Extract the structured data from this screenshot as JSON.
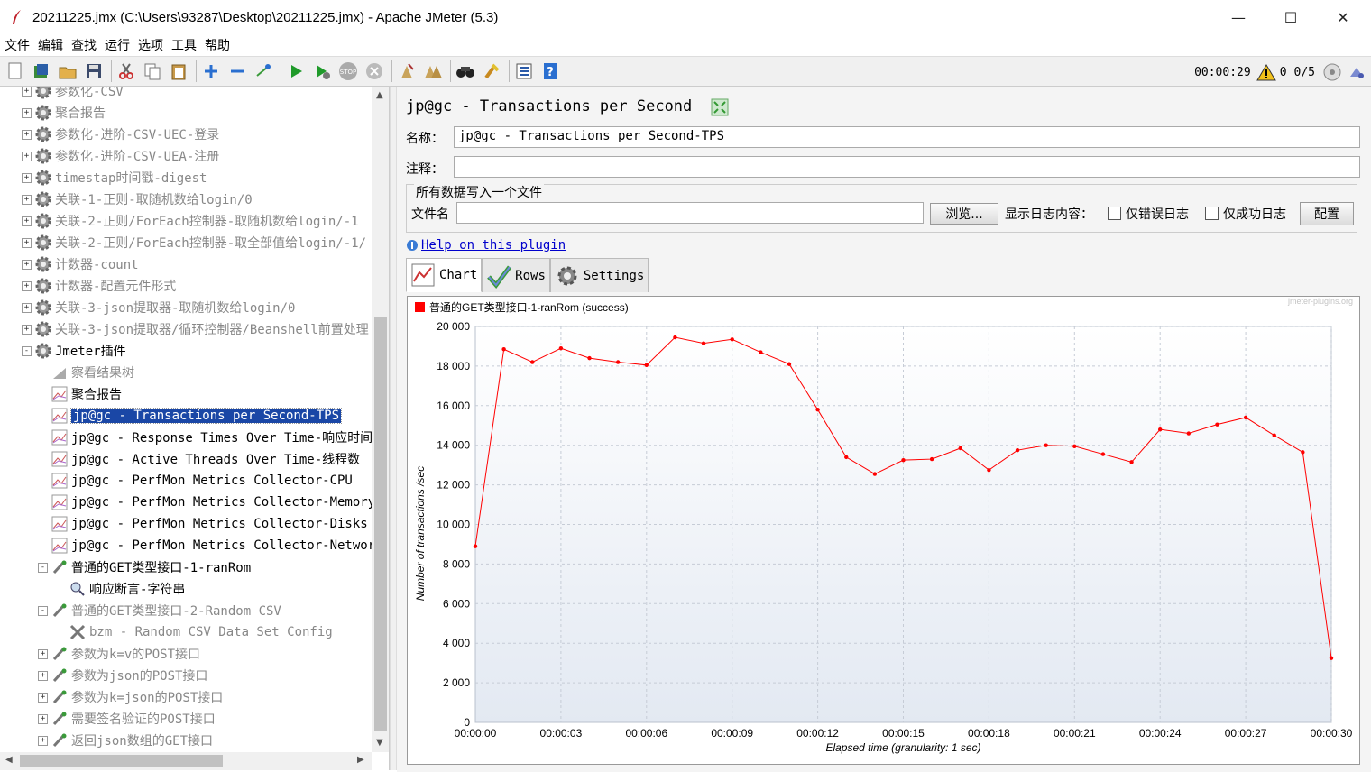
{
  "window": {
    "title": "20211225.jmx (C:\\Users\\93287\\Desktop\\20211225.jmx) - Apache JMeter (5.3)",
    "min_glyph": "—",
    "max_glyph": "☐",
    "close_glyph": "✕"
  },
  "menu": [
    "文件",
    "编辑",
    "查找",
    "运行",
    "选项",
    "工具",
    "帮助"
  ],
  "toolbar": {
    "icons": [
      "new-icon",
      "templates-icon",
      "open-icon",
      "save-icon",
      "cut-icon",
      "copy-icon",
      "paste-icon",
      "expand-icon",
      "collapse-icon",
      "toggle-icon",
      "start-icon",
      "start-no-pause-icon",
      "stop-icon",
      "shutdown-icon",
      "clear-icon",
      "clear-all-icon",
      "search-icon",
      "reset-search-icon",
      "function-helper-icon",
      "help-icon"
    ],
    "elapsed": "00:00:29",
    "warnings": "0",
    "threads": "0/5"
  },
  "tree": [
    {
      "label": "参数化-CSV",
      "icon": "gear-icon",
      "indent": 0,
      "expander": "+",
      "disabled": true
    },
    {
      "label": "聚合报告",
      "icon": "gear-icon",
      "indent": 0,
      "expander": "+",
      "disabled": true
    },
    {
      "label": "参数化-进阶-CSV-UEC-登录",
      "icon": "gear-icon",
      "indent": 0,
      "expander": "+",
      "disabled": true
    },
    {
      "label": "参数化-进阶-CSV-UEA-注册",
      "icon": "gear-icon",
      "indent": 0,
      "expander": "+",
      "disabled": true
    },
    {
      "label": "timestap时间戳-digest",
      "icon": "gear-icon",
      "indent": 0,
      "expander": "+",
      "disabled": true
    },
    {
      "label": "关联-1-正则-取随机数给login/0",
      "icon": "gear-icon",
      "indent": 0,
      "expander": "+",
      "disabled": true
    },
    {
      "label": "关联-2-正则/ForEach控制器-取随机数给login/-1",
      "icon": "gear-icon",
      "indent": 0,
      "expander": "+",
      "disabled": true
    },
    {
      "label": "关联-2-正则/ForEach控制器-取全部值给login/-1/",
      "icon": "gear-icon",
      "indent": 0,
      "expander": "+",
      "disabled": true
    },
    {
      "label": "计数器-count",
      "icon": "gear-icon",
      "indent": 0,
      "expander": "+",
      "disabled": true
    },
    {
      "label": "计数器-配置元件形式",
      "icon": "gear-icon",
      "indent": 0,
      "expander": "+",
      "disabled": true
    },
    {
      "label": "关联-3-json提取器-取随机数给login/0",
      "icon": "gear-icon",
      "indent": 0,
      "expander": "+",
      "disabled": true
    },
    {
      "label": "关联-3-json提取器/循环控制器/Beanshell前置处理",
      "icon": "gear-icon",
      "indent": 0,
      "expander": "+",
      "disabled": true
    },
    {
      "label": "Jmeter插件",
      "icon": "gear-icon",
      "indent": 0,
      "expander": "-",
      "disabled": false
    },
    {
      "label": "察看结果树",
      "icon": "graph-icon",
      "indent": 1,
      "expander": "",
      "disabled": true
    },
    {
      "label": "聚合报告",
      "icon": "chart-icon",
      "indent": 1,
      "expander": "",
      "disabled": false
    },
    {
      "label": "jp@gc - Transactions per Second-TPS",
      "icon": "chart-icon",
      "indent": 1,
      "expander": "",
      "disabled": false,
      "selected": true
    },
    {
      "label": "jp@gc - Response Times Over Time-响应时间",
      "icon": "chart-icon",
      "indent": 1,
      "expander": "",
      "disabled": false
    },
    {
      "label": "jp@gc - Active Threads Over Time-线程数",
      "icon": "chart-icon",
      "indent": 1,
      "expander": "",
      "disabled": false
    },
    {
      "label": "jp@gc - PerfMon Metrics Collector-CPU",
      "icon": "chart-icon",
      "indent": 1,
      "expander": "",
      "disabled": false
    },
    {
      "label": "jp@gc - PerfMon Metrics Collector-Memory",
      "icon": "chart-icon",
      "indent": 1,
      "expander": "",
      "disabled": false
    },
    {
      "label": "jp@gc - PerfMon Metrics Collector-Disks",
      "icon": "chart-icon",
      "indent": 1,
      "expander": "",
      "disabled": false
    },
    {
      "label": "jp@gc - PerfMon Metrics Collector-Network",
      "icon": "chart-icon",
      "indent": 1,
      "expander": "",
      "disabled": false
    },
    {
      "label": "普通的GET类型接口-1-ranRom",
      "icon": "sampler-icon",
      "indent": 1,
      "expander": "-",
      "disabled": false
    },
    {
      "label": "响应断言-字符串",
      "icon": "magnifier-icon",
      "indent": 2,
      "expander": "",
      "disabled": false
    },
    {
      "label": "普通的GET类型接口-2-Random CSV",
      "icon": "sampler-icon",
      "indent": 1,
      "expander": "-",
      "disabled": true
    },
    {
      "label": "bzm - Random CSV Data Set Config",
      "icon": "tools-icon",
      "indent": 2,
      "expander": "",
      "disabled": true
    },
    {
      "label": "参数为k=v的POST接口",
      "icon": "sampler-icon",
      "indent": 1,
      "expander": "+",
      "disabled": true
    },
    {
      "label": "参数为json的POST接口",
      "icon": "sampler-icon",
      "indent": 1,
      "expander": "+",
      "disabled": true
    },
    {
      "label": "参数为k=json的POST接口",
      "icon": "sampler-icon",
      "indent": 1,
      "expander": "+",
      "disabled": true
    },
    {
      "label": "需要签名验证的POST接口",
      "icon": "sampler-icon",
      "indent": 1,
      "expander": "+",
      "disabled": true
    },
    {
      "label": "返回json数组的GET接口",
      "icon": "sampler-icon",
      "indent": 1,
      "expander": "+",
      "disabled": true
    }
  ],
  "panel": {
    "title": "jp@gc - Transactions per Second",
    "name_label": "名称：",
    "name_value": "jp@gc - Transactions per Second-TPS",
    "comment_label": "注释：",
    "comment_value": "",
    "write_group_label": "所有数据写入一个文件",
    "filename_label": "文件名",
    "filename_value": "",
    "browse_button": "浏览...",
    "log_content_label": "显示日志内容：",
    "errors_only_label": "仅错误日志",
    "success_only_label": "仅成功日志",
    "configure_button": "配置",
    "help_link": "Help on this plugin",
    "tabs": [
      {
        "label": "Chart",
        "icon": "chart-tab-icon"
      },
      {
        "label": "Rows",
        "icon": "checkmark-icon"
      },
      {
        "label": "Settings",
        "icon": "gear-icon"
      }
    ]
  },
  "chart_data": {
    "type": "line",
    "watermark": "jmeter-plugins.org",
    "xlabel": "Elapsed time (granularity: 1 sec)",
    "ylabel": "Number of transactions /sec",
    "ylim": [
      0,
      20000
    ],
    "yticks": [
      "0",
      "2 000",
      "4 000",
      "6 000",
      "8 000",
      "10 000",
      "12 000",
      "14 000",
      "16 000",
      "18 000",
      "20 000"
    ],
    "xticks": [
      "00:00:00",
      "00:00:03",
      "00:00:06",
      "00:00:09",
      "00:00:12",
      "00:00:15",
      "00:00:18",
      "00:00:21",
      "00:00:24",
      "00:00:27",
      "00:00:30"
    ],
    "xlim": [
      0,
      30
    ],
    "grid": true,
    "legend_position": "top-left",
    "series": [
      {
        "name": "普通的GET类型接口-1-ranRom (success)",
        "color": "#ff0000",
        "x": [
          0,
          1,
          2,
          3,
          4,
          5,
          6,
          7,
          8,
          9,
          10,
          11,
          12,
          13,
          14,
          15,
          16,
          17,
          18,
          19,
          20,
          21,
          22,
          23,
          24,
          25,
          26,
          27,
          28,
          29,
          30
        ],
        "values": [
          8900,
          18850,
          18200,
          18900,
          18400,
          18200,
          18050,
          19450,
          19150,
          19350,
          18700,
          18100,
          15800,
          13400,
          12550,
          13250,
          13300,
          13850,
          12750,
          13750,
          14000,
          13950,
          13550,
          13150,
          14800,
          14600,
          15050,
          15400,
          14500,
          13650,
          3250
        ]
      }
    ]
  }
}
